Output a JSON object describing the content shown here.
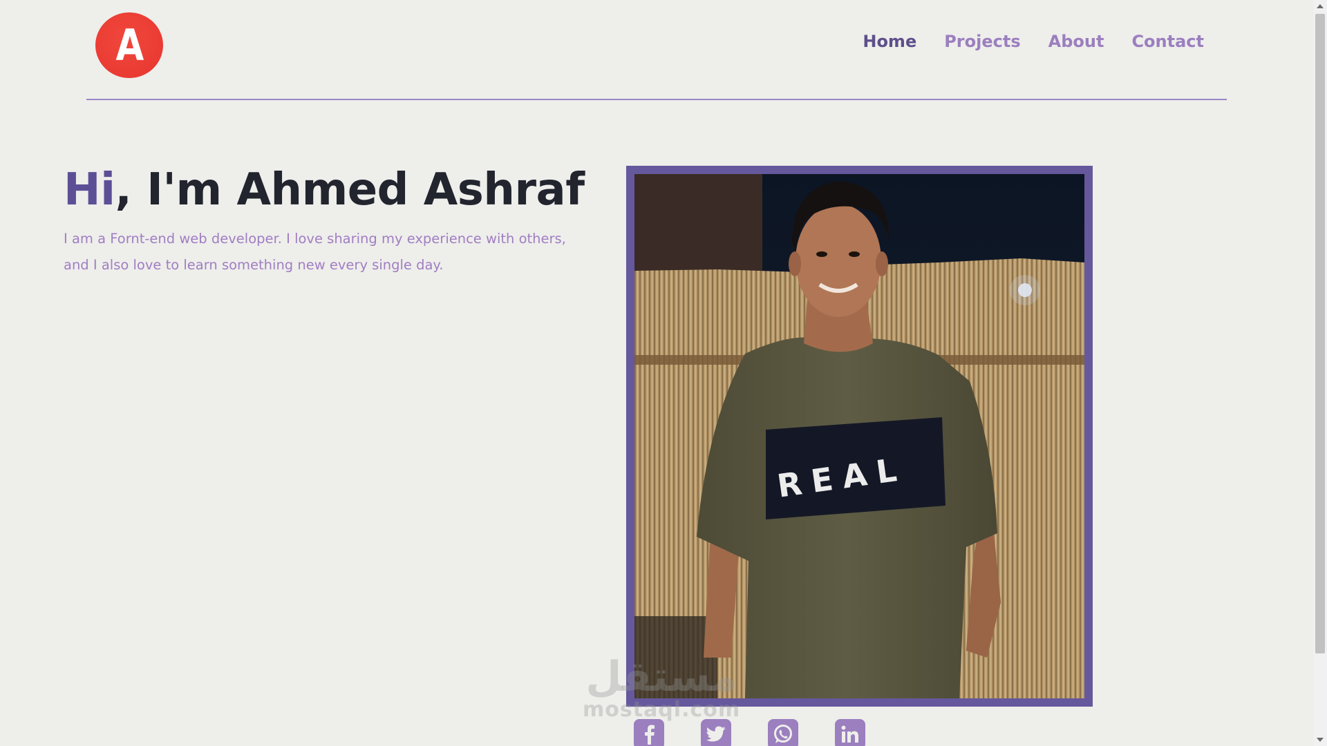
{
  "header": {
    "logo_letter": "A",
    "nav": {
      "home": "Home",
      "projects": "Projects",
      "about": "About",
      "contact": "Contact",
      "active": "home"
    }
  },
  "hero": {
    "greeting": "Hi",
    "title_rest": ", I'm Ahmed Ashraf",
    "description": "I am a Fornt-end web developer. I love sharing my experience with others, and I also love to learn something new every single day."
  },
  "photo": {
    "shirt_text": "REAL"
  },
  "socials": [
    {
      "icon": "facebook-icon"
    },
    {
      "icon": "twitter-icon"
    },
    {
      "icon": "whatsapp-icon"
    },
    {
      "icon": "linkedin-icon"
    }
  ],
  "watermark": {
    "arabic": "مستقل",
    "latin": "mostaql.com"
  },
  "colors": {
    "background": "#eeeeeb",
    "accent_dark": "#5d4f96",
    "accent_light": "#9b7fbe",
    "frame": "#65589c",
    "logo": "#ea3b33",
    "heading": "#22242e"
  }
}
